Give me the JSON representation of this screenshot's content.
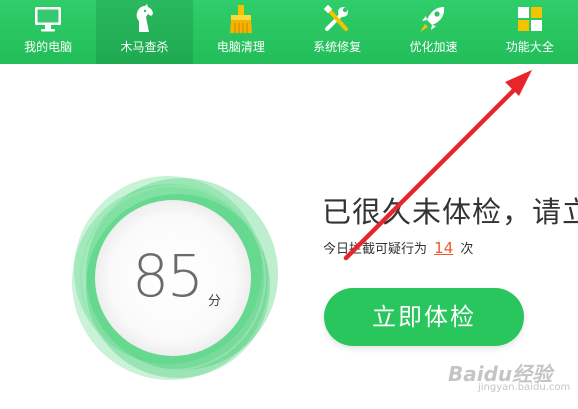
{
  "toolbar": {
    "items": [
      {
        "label": "我的电脑",
        "icon": "monitor-icon"
      },
      {
        "label": "木马查杀",
        "icon": "horse-icon"
      },
      {
        "label": "电脑清理",
        "icon": "broom-icon"
      },
      {
        "label": "系统修复",
        "icon": "tools-icon"
      },
      {
        "label": "优化加速",
        "icon": "rocket-icon"
      },
      {
        "label": "功能大全",
        "icon": "grid-icon"
      }
    ],
    "active_index": 1
  },
  "score": {
    "value": "85",
    "unit": "分"
  },
  "message": {
    "headline": "已很久未体检，请立",
    "sub_prefix": "今日拦截可疑行为",
    "sub_count": "14",
    "sub_suffix": "次"
  },
  "check_button": {
    "label": "立即体检"
  },
  "watermark": {
    "brand": "Baidu经验",
    "site": "jingyan.baidu.com"
  },
  "colors": {
    "toolbar_green": "#27c45e",
    "button_green": "#29c55d",
    "count_orange": "#ef5a2a",
    "arrow_red": "#e8262a"
  }
}
